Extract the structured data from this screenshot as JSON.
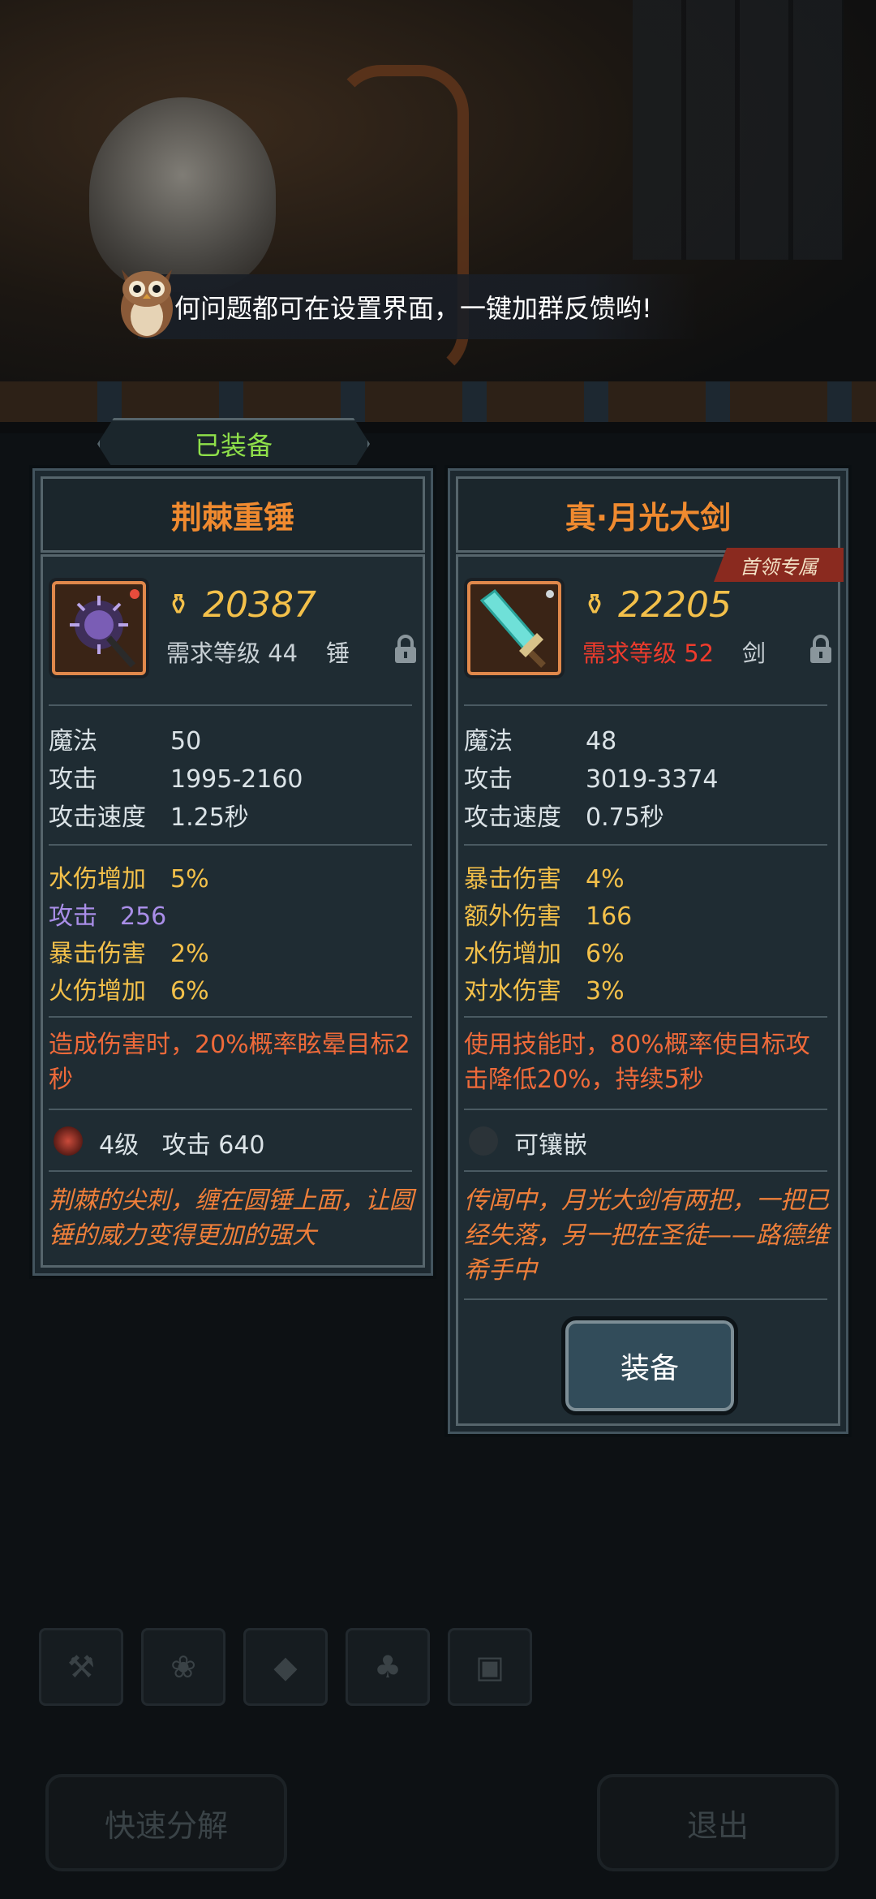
{
  "tip": {
    "text": "何问题都可在设置界面，一键加群反馈哟!",
    "icon": "owl-icon"
  },
  "equipped_badge": "已装备",
  "left": {
    "name": "荆棘重锤",
    "score": "20387",
    "required_level": "需求等级 44",
    "type": "锤",
    "base_stats": [
      {
        "k": "魔法",
        "v": "50"
      },
      {
        "k": "攻击",
        "v": "1995-2160"
      },
      {
        "k": "攻击速度",
        "v": "1.25秒"
      }
    ],
    "extra_stats": [
      {
        "k": "水伤增加",
        "v": "5%",
        "style": "gold"
      },
      {
        "k": "攻击",
        "v": "256",
        "style": "purple"
      },
      {
        "k": "暴击伤害",
        "v": "2%",
        "style": "gold"
      },
      {
        "k": "火伤增加",
        "v": "6%",
        "style": "gold"
      }
    ],
    "effect": "造成伤害时，20%概率眩晕目标2秒",
    "gem": "4级   攻击 640",
    "lore": "荆棘的尖刺，缠在圆锤上面，让圆锤的威力变得更加的强大"
  },
  "right": {
    "name": "真·月光大剑",
    "boss_tag": "首领专属",
    "score": "22205",
    "required_level": "需求等级 52",
    "type": "剑",
    "base_stats": [
      {
        "k": "魔法",
        "v": "48"
      },
      {
        "k": "攻击",
        "v": "3019-3374"
      },
      {
        "k": "攻击速度",
        "v": "0.75秒"
      }
    ],
    "extra_stats": [
      {
        "k": "暴击伤害",
        "v": "4%",
        "style": "gold"
      },
      {
        "k": "额外伤害",
        "v": "166",
        "style": "gold"
      },
      {
        "k": "水伤增加",
        "v": "6%",
        "style": "gold"
      },
      {
        "k": "对水伤害",
        "v": "3%",
        "style": "gold"
      }
    ],
    "effect": "使用技能时，80%概率使目标攻击降低20%，持续5秒",
    "socket": "可镶嵌",
    "lore": "传闻中，月光大剑有两把，一把已经失落，另一把在圣徒——路德维希手中",
    "equip_button": "装备"
  },
  "bottom": {
    "quick_decompose": "快速分解",
    "exit": "退出"
  },
  "tabs": [
    "hammer-icon",
    "paw-icon",
    "gem-icon",
    "tree-icon",
    "chest-icon"
  ],
  "colors": {
    "title": "#f08a2f",
    "gold": "#f3c04a",
    "red": "#ee3b2c",
    "purple": "#a98ee8",
    "green": "#8fe04a"
  }
}
